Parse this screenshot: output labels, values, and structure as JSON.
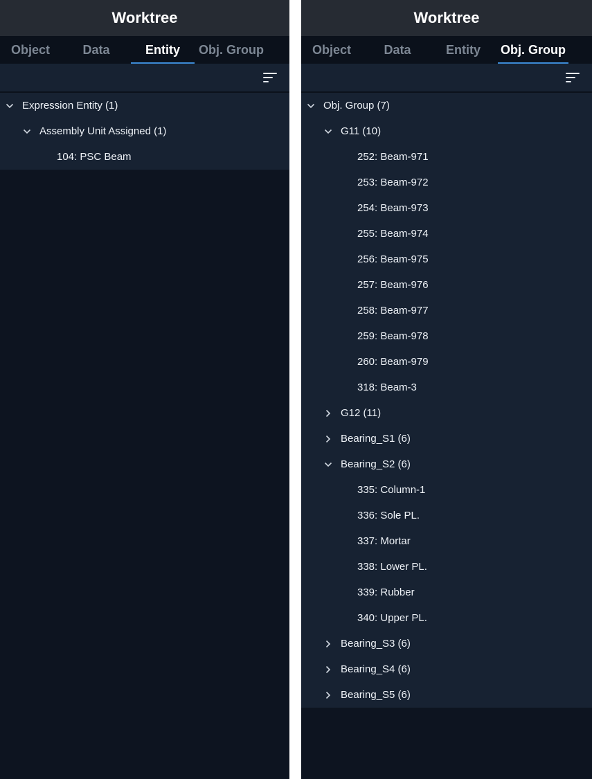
{
  "left": {
    "title": "Worktree",
    "tabs": [
      "Object",
      "Data",
      "Entity",
      "Obj. Group"
    ],
    "active_tab": "Entity",
    "tree": {
      "root": "Expression Entity (1)",
      "child": "Assembly Unit Assigned (1)",
      "leaf": "104: PSC Beam"
    }
  },
  "right": {
    "title": "Worktree",
    "tabs": [
      "Object",
      "Data",
      "Entity",
      "Obj. Group"
    ],
    "active_tab": "Obj. Group",
    "tree": {
      "root": "Obj. Group (7)",
      "g11": {
        "label": "G11 (10)",
        "items": [
          "252: Beam-971",
          "253: Beam-972",
          "254: Beam-973",
          "255: Beam-974",
          "256: Beam-975",
          "257: Beam-976",
          "258: Beam-977",
          "259: Beam-978",
          "260: Beam-979",
          "318: Beam-3"
        ]
      },
      "g12": "G12 (11)",
      "bearing_s1": "Bearing_S1 (6)",
      "bearing_s2": {
        "label": "Bearing_S2 (6)",
        "items": [
          "335: Column-1",
          "336: Sole PL.",
          "337: Mortar",
          "338: Lower PL.",
          "339: Rubber",
          "340: Upper PL."
        ]
      },
      "bearing_s3": "Bearing_S3 (6)",
      "bearing_s4": "Bearing_S4 (6)",
      "bearing_s5": "Bearing_S5 (6)"
    }
  },
  "icons": {
    "expanded": "chevron-down-icon",
    "collapsed": "chevron-right-icon",
    "sort": "sort-icon"
  },
  "colors": {
    "accent": "#3d8ad6",
    "panel_bg": "#0d1420",
    "tree_bg": "#172232",
    "title_bg": "#262b33"
  }
}
